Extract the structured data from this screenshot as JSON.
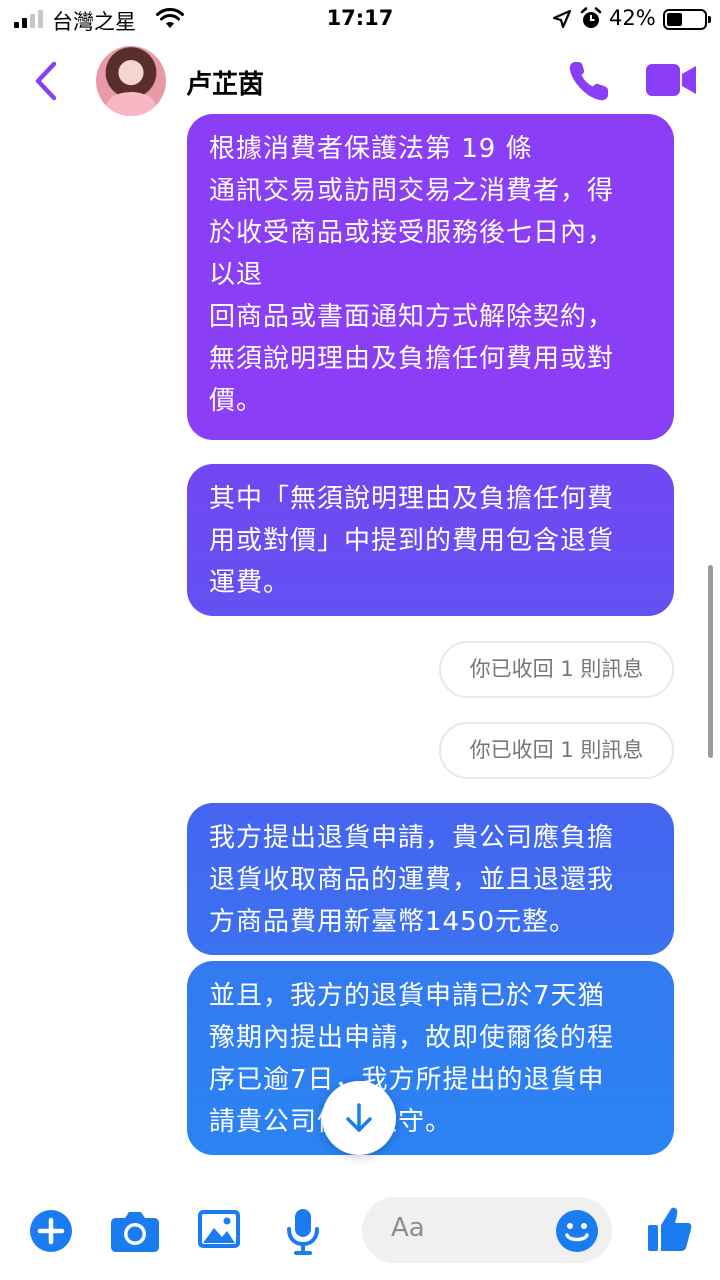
{
  "status_bar": {
    "carrier": "台灣之星",
    "time": "17:17",
    "battery": "42%",
    "battery_level": 0.42
  },
  "header": {
    "contact_name": "卢芷茵"
  },
  "messages": [
    {
      "lines": [
        "根據消費者保護法第 19 條",
        "通訊交易或訪問交易之消費者，得",
        "於收受商品或接受服務後七日內，",
        "以退",
        "回商品或書面通知方式解除契約，",
        "無須說明理由及負擔任何費用或對",
        "價。"
      ]
    },
    {
      "lines": [
        "其中「無須說明理由及負擔任何費",
        "用或對價」中提到的費用包含退貨",
        "運費。"
      ]
    },
    {
      "lines": [
        "我方提出退貨申請，貴公司應負擔",
        "退貨收取商品的運費，並且退還我",
        "方商品費用新臺幣1450元整。"
      ]
    },
    {
      "lines": [
        "並且，我方的退貨申請已於7天猶",
        "豫期內提出申請，故即使爾後的程",
        "序已逾7日，我方所提出的退貨申",
        "請貴公司仍應遵守。"
      ]
    }
  ],
  "recalled_notices": [
    "你已收回 1 則訊息",
    "你已收回 1 則訊息"
  ],
  "composer": {
    "placeholder": "Aa"
  },
  "icons": {
    "back": "chevron-left-icon",
    "call": "phone-icon",
    "video": "video-camera-icon",
    "add": "plus-circle-icon",
    "camera": "camera-icon",
    "gallery": "image-icon",
    "mic": "microphone-icon",
    "emoji": "smiley-icon",
    "like": "thumbs-up-icon",
    "jump": "arrow-down-icon"
  },
  "colors": {
    "accent": "#8a3ef5",
    "blue": "#1b7cf2"
  }
}
